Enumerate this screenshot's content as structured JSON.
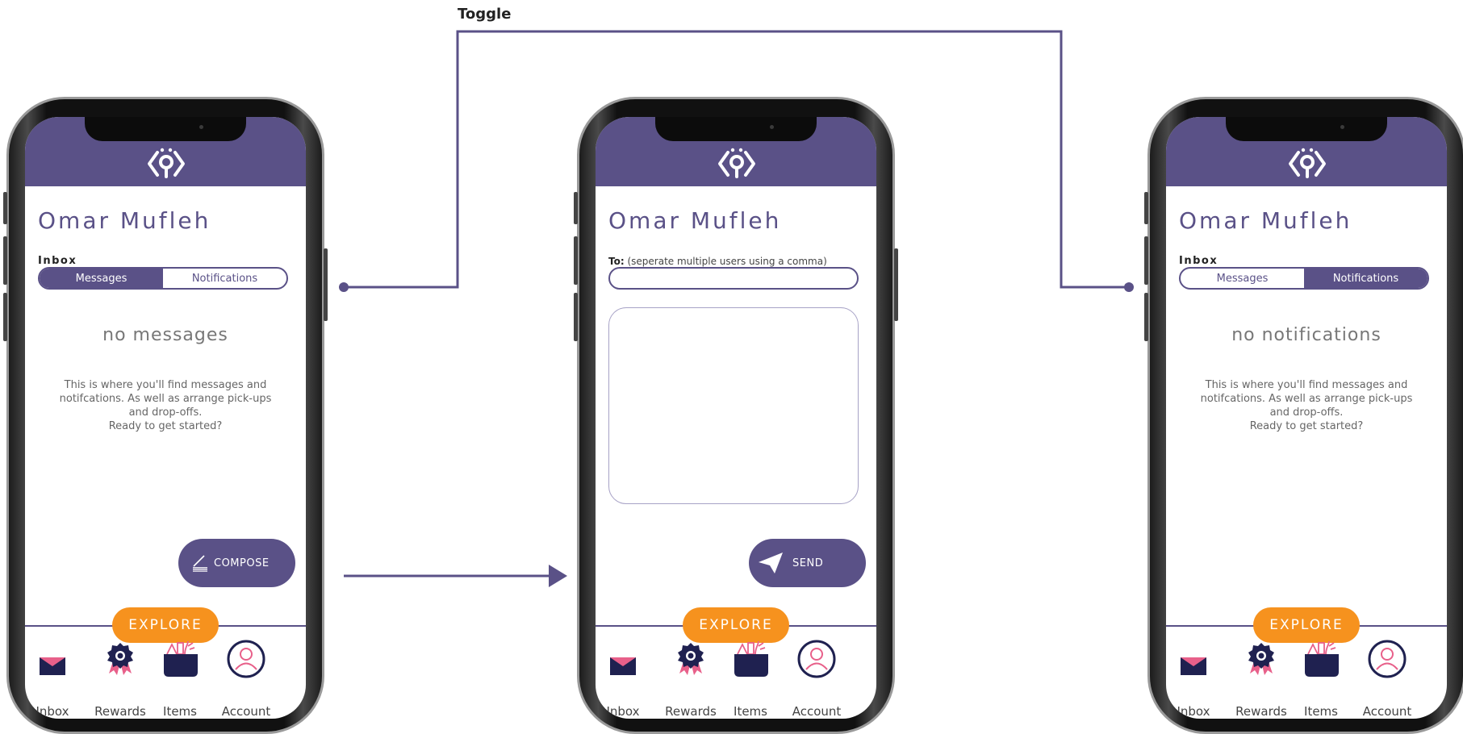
{
  "flow": {
    "toggle_label": "Toggle"
  },
  "colors": {
    "brand_purple": "#5a5187",
    "explore_orange": "#f6921e",
    "navy": "#1f2150",
    "pink": "#e8608a"
  },
  "screens": [
    {
      "id": "inbox-messages",
      "title": "Omar Mufleh",
      "inbox_label": "Inbox",
      "tabs": [
        {
          "label": "Messages",
          "active": true
        },
        {
          "label": "Notifications",
          "active": false
        }
      ],
      "empty_title": "no messages",
      "empty_lines": [
        "This is where you'll find messages and",
        "notifcations. As well as arrange pick-ups",
        "and drop-offs.",
        "Ready to get started?"
      ],
      "action_button": {
        "label": "COMPOSE",
        "icon": "compose-icon"
      }
    },
    {
      "id": "compose",
      "title": "Omar Mufleh",
      "to_label": "To:",
      "to_hint": "(seperate multiple users using a comma)",
      "to_value": "",
      "message_value": "",
      "action_button": {
        "label": "SEND",
        "icon": "paper-plane-icon"
      }
    },
    {
      "id": "inbox-notifications",
      "title": "Omar Mufleh",
      "inbox_label": "Inbox",
      "tabs": [
        {
          "label": "Messages",
          "active": false
        },
        {
          "label": "Notifications",
          "active": true
        }
      ],
      "empty_title": "no notifications",
      "empty_lines": [
        "This is where you'll find messages and",
        "notifcations. As well as arrange pick-ups",
        "and drop-offs.",
        "Ready to get started?"
      ]
    }
  ],
  "explore_label": "EXPLORE",
  "nav": [
    {
      "label": "Inbox",
      "icon": "envelope-icon"
    },
    {
      "label": "Rewards",
      "icon": "award-ribbon-icon"
    },
    {
      "label": "Items",
      "icon": "basket-icon"
    },
    {
      "label": "Account",
      "icon": "user-circle-icon"
    }
  ]
}
